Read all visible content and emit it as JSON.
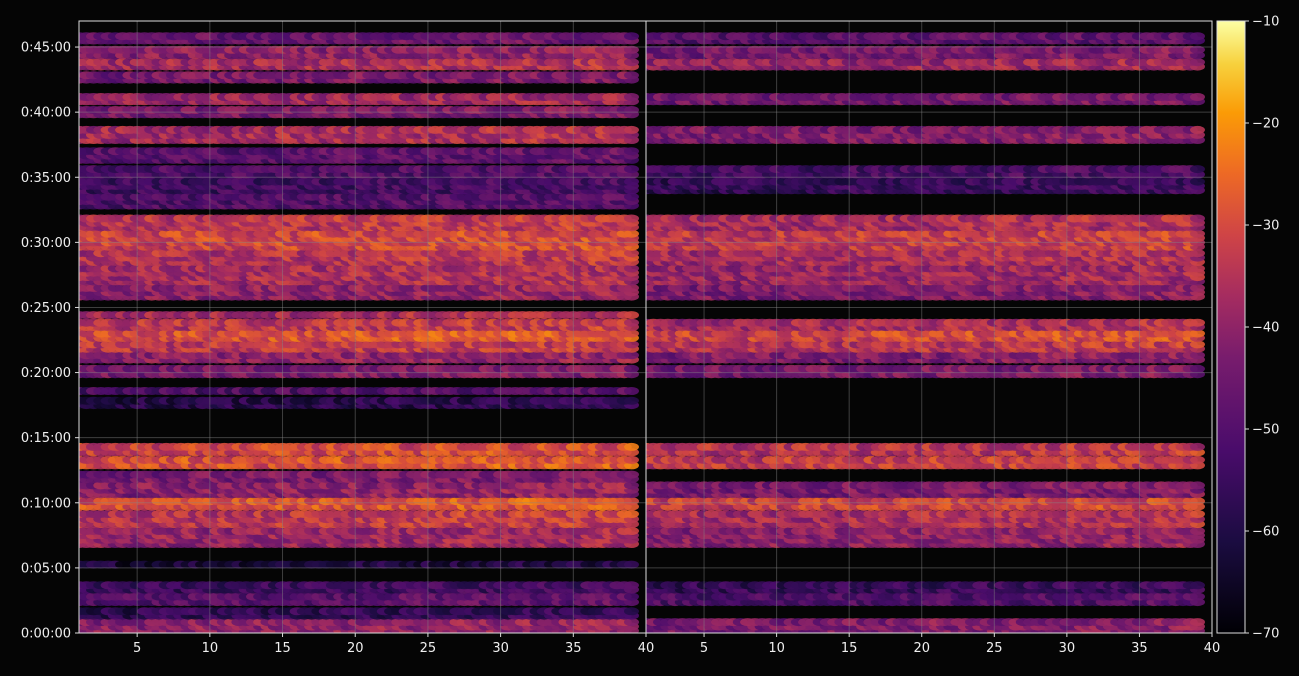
{
  "chart_data": {
    "type": "heatmap",
    "title": "",
    "xlabel": "",
    "ylabel": "",
    "colormap": "inferno",
    "background": "#050505",
    "grid": true,
    "grid_color": "#888888",
    "axis_color": "#dddddd",
    "xlim": [
      1,
      40
    ],
    "ylim_seconds": [
      0,
      2820
    ],
    "y_ticks": [
      {
        "label": "0:00:00",
        "value": 0
      },
      {
        "label": "0:05:00",
        "value": 300
      },
      {
        "label": "0:10:00",
        "value": 600
      },
      {
        "label": "0:15:00",
        "value": 900
      },
      {
        "label": "0:20:00",
        "value": 1200
      },
      {
        "label": "0:25:00",
        "value": 1500
      },
      {
        "label": "0:30:00",
        "value": 1800
      },
      {
        "label": "0:35:00",
        "value": 2100
      },
      {
        "label": "0:40:00",
        "value": 2400
      },
      {
        "label": "0:45:00",
        "value": 2700
      }
    ],
    "panels": [
      {
        "name": "left",
        "x_ticks": [
          {
            "label": "5",
            "value": 5
          },
          {
            "label": "10",
            "value": 10
          },
          {
            "label": "15",
            "value": 15
          },
          {
            "label": "20",
            "value": 20
          },
          {
            "label": "25",
            "value": 25
          },
          {
            "label": "30",
            "value": 30
          },
          {
            "label": "35",
            "value": 35
          },
          {
            "label": "40",
            "value": 40
          }
        ],
        "bands": [
          {
            "t0": 0,
            "t1": 60,
            "level": -42
          },
          {
            "t0": 70,
            "t1": 110,
            "level": -58
          },
          {
            "t0": 130,
            "t1": 180,
            "level": -50
          },
          {
            "t0": 190,
            "t1": 230,
            "level": -56
          },
          {
            "t0": 300,
            "t1": 330,
            "level": -62
          },
          {
            "t0": 400,
            "t1": 480,
            "level": -40
          },
          {
            "t0": 490,
            "t1": 560,
            "level": -35
          },
          {
            "t0": 570,
            "t1": 620,
            "level": -30
          },
          {
            "t0": 630,
            "t1": 690,
            "level": -42
          },
          {
            "t0": 700,
            "t1": 740,
            "level": -45
          },
          {
            "t0": 760,
            "t1": 810,
            "level": -30
          },
          {
            "t0": 820,
            "t1": 870,
            "level": -32
          },
          {
            "t0": 1040,
            "t1": 1080,
            "level": -60
          },
          {
            "t0": 1100,
            "t1": 1130,
            "level": -52
          },
          {
            "t0": 1180,
            "t1": 1230,
            "level": -45
          },
          {
            "t0": 1250,
            "t1": 1290,
            "level": -42
          },
          {
            "t0": 1300,
            "t1": 1340,
            "level": -35
          },
          {
            "t0": 1350,
            "t1": 1390,
            "level": -30
          },
          {
            "t0": 1400,
            "t1": 1440,
            "level": -35
          },
          {
            "t0": 1450,
            "t1": 1480,
            "level": -38
          },
          {
            "t0": 1540,
            "t1": 1600,
            "level": -42
          },
          {
            "t0": 1610,
            "t1": 1690,
            "level": -38
          },
          {
            "t0": 1700,
            "t1": 1760,
            "level": -36
          },
          {
            "t0": 1770,
            "t1": 1850,
            "level": -32
          },
          {
            "t0": 1860,
            "t1": 1920,
            "level": -35
          },
          {
            "t0": 1960,
            "t1": 2020,
            "level": -52
          },
          {
            "t0": 2030,
            "t1": 2090,
            "level": -55
          },
          {
            "t0": 2100,
            "t1": 2150,
            "level": -52
          },
          {
            "t0": 2170,
            "t1": 2230,
            "level": -50
          },
          {
            "t0": 2260,
            "t1": 2330,
            "level": -38
          },
          {
            "t0": 2380,
            "t1": 2420,
            "level": -45
          },
          {
            "t0": 2440,
            "t1": 2480,
            "level": -40
          },
          {
            "t0": 2540,
            "t1": 2580,
            "level": -45
          },
          {
            "t0": 2600,
            "t1": 2640,
            "level": -38
          },
          {
            "t0": 2650,
            "t1": 2700,
            "level": -42
          },
          {
            "t0": 2720,
            "t1": 2760,
            "level": -48
          }
        ]
      },
      {
        "name": "right",
        "x_ticks": [
          {
            "label": "5",
            "value": 5
          },
          {
            "label": "10",
            "value": 10
          },
          {
            "label": "15",
            "value": 15
          },
          {
            "label": "20",
            "value": 20
          },
          {
            "label": "25",
            "value": 25
          },
          {
            "label": "30",
            "value": 30
          },
          {
            "label": "35",
            "value": 35
          },
          {
            "label": "40",
            "value": 40
          }
        ],
        "bands": [
          {
            "t0": 0,
            "t1": 60,
            "level": -44
          },
          {
            "t0": 130,
            "t1": 180,
            "level": -52
          },
          {
            "t0": 190,
            "t1": 230,
            "level": -57
          },
          {
            "t0": 400,
            "t1": 480,
            "level": -42
          },
          {
            "t0": 490,
            "t1": 560,
            "level": -38
          },
          {
            "t0": 570,
            "t1": 620,
            "level": -33
          },
          {
            "t0": 630,
            "t1": 690,
            "level": -45
          },
          {
            "t0": 760,
            "t1": 810,
            "level": -34
          },
          {
            "t0": 820,
            "t1": 870,
            "level": -36
          },
          {
            "t0": 1180,
            "t1": 1230,
            "level": -45
          },
          {
            "t0": 1250,
            "t1": 1290,
            "level": -44
          },
          {
            "t0": 1300,
            "t1": 1340,
            "level": -36
          },
          {
            "t0": 1350,
            "t1": 1390,
            "level": -32
          },
          {
            "t0": 1400,
            "t1": 1440,
            "level": -38
          },
          {
            "t0": 1540,
            "t1": 1600,
            "level": -44
          },
          {
            "t0": 1610,
            "t1": 1690,
            "level": -40
          },
          {
            "t0": 1700,
            "t1": 1760,
            "level": -38
          },
          {
            "t0": 1770,
            "t1": 1850,
            "level": -34
          },
          {
            "t0": 1860,
            "t1": 1920,
            "level": -38
          },
          {
            "t0": 2030,
            "t1": 2090,
            "level": -57
          },
          {
            "t0": 2100,
            "t1": 2150,
            "level": -54
          },
          {
            "t0": 2260,
            "t1": 2330,
            "level": -44
          },
          {
            "t0": 2440,
            "t1": 2480,
            "level": -46
          },
          {
            "t0": 2600,
            "t1": 2640,
            "level": -40
          },
          {
            "t0": 2650,
            "t1": 2700,
            "level": -45
          },
          {
            "t0": 2720,
            "t1": 2760,
            "level": -50
          }
        ]
      }
    ],
    "colorbar": {
      "min": -70,
      "max": -10,
      "ticks": [
        {
          "label": "−10",
          "value": -10
        },
        {
          "label": "−20",
          "value": -20
        },
        {
          "label": "−30",
          "value": -30
        },
        {
          "label": "−40",
          "value": -40
        },
        {
          "label": "−50",
          "value": -50
        },
        {
          "label": "−60",
          "value": -60
        },
        {
          "label": "−70",
          "value": -70
        }
      ]
    }
  }
}
